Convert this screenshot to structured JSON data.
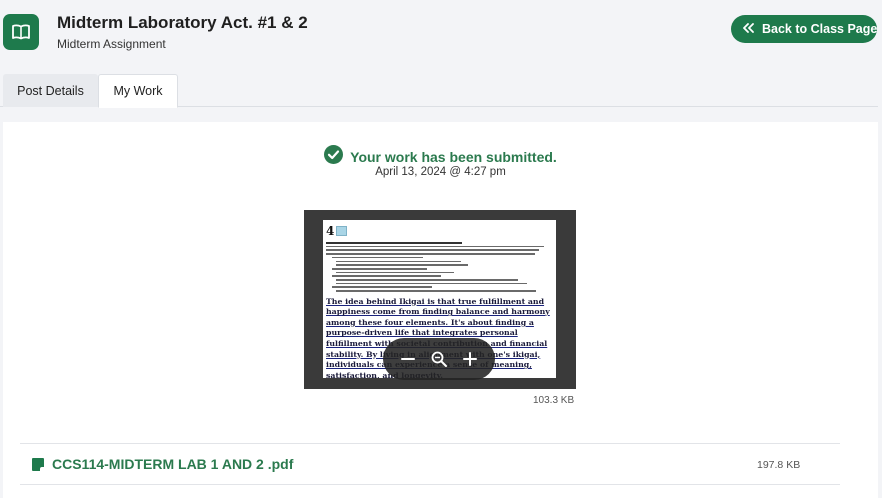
{
  "header": {
    "title": "Midterm Laboratory Act. #1 & 2",
    "subtitle": "Midterm Assignment",
    "back_button": "Back to Class Page",
    "icon": "open-book-icon"
  },
  "tabs": [
    {
      "label": "Post Details",
      "active": false
    },
    {
      "label": "My Work",
      "active": true
    }
  ],
  "submission": {
    "status": "Your work has been submitted.",
    "timestamp": "April 13, 2024 @ 4:27 pm",
    "status_icon": "check-circle-icon"
  },
  "preview": {
    "page_number": "4",
    "heading": "IKIGAI: THE JAPANESE SECRET TO A LONG AND HAPPY LIFE",
    "highlight_text": "The idea behind Ikigai is that true fulfillment and happiness come from finding balance and harmony among these four elements. It's about finding a purpose-driven life that integrates personal fulfillment with societal contribution and financial stability. By living in alignment with one's ikigai, individuals can experience a sense of meaning, satisfaction, and longevity.",
    "image_size": "103.3 KB",
    "zoom_controls": [
      "minus-icon",
      "zoom-icon",
      "plus-icon"
    ]
  },
  "attachment": {
    "file_name": "CCS114-MIDTERM LAB 1 AND 2 .pdf",
    "file_size": "197.8 KB",
    "icon": "file-icon"
  },
  "colors": {
    "brand": "#1e7a4c",
    "status_text": "#2b7a4e",
    "background": "#f3f4f7"
  }
}
